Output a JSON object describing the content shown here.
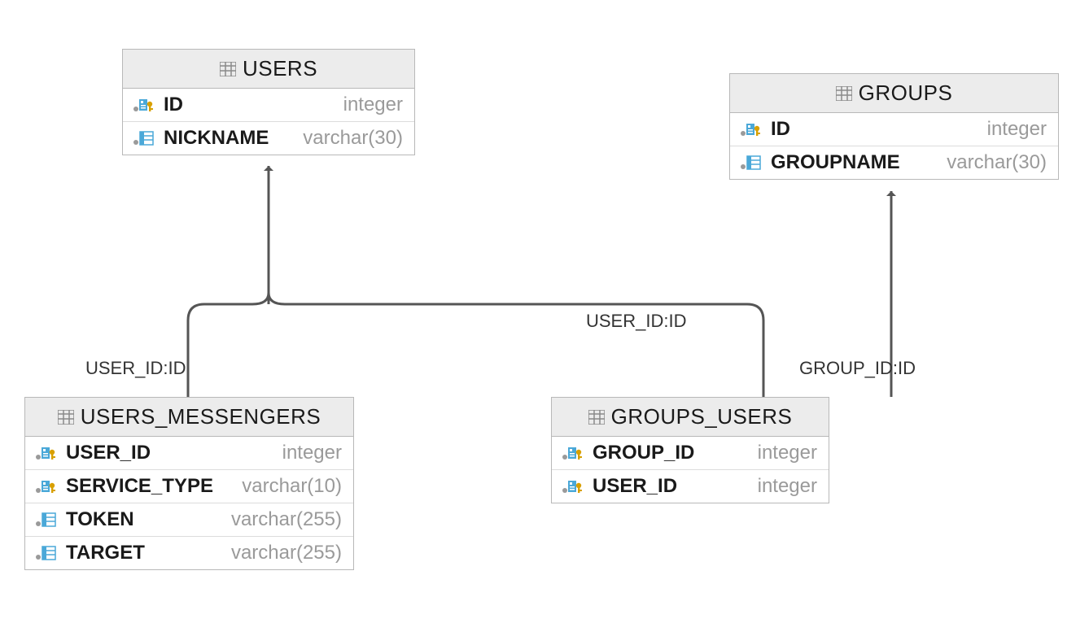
{
  "tables": {
    "users": {
      "title": "USERS",
      "columns": [
        {
          "name": "ID",
          "type": "integer",
          "icon": "pk"
        },
        {
          "name": "NICKNAME",
          "type": "varchar(30)",
          "icon": "col"
        }
      ]
    },
    "groups": {
      "title": "GROUPS",
      "columns": [
        {
          "name": "ID",
          "type": "integer",
          "icon": "pk"
        },
        {
          "name": "GROUPNAME",
          "type": "varchar(30)",
          "icon": "col"
        }
      ]
    },
    "users_messengers": {
      "title": "USERS_MESSENGERS",
      "columns": [
        {
          "name": "USER_ID",
          "type": "integer",
          "icon": "pk"
        },
        {
          "name": "SERVICE_TYPE",
          "type": "varchar(10)",
          "icon": "pk"
        },
        {
          "name": "TOKEN",
          "type": "varchar(255)",
          "icon": "col"
        },
        {
          "name": "TARGET",
          "type": "varchar(255)",
          "icon": "col"
        }
      ]
    },
    "groups_users": {
      "title": "GROUPS_USERS",
      "columns": [
        {
          "name": "GROUP_ID",
          "type": "integer",
          "icon": "pk"
        },
        {
          "name": "USER_ID",
          "type": "integer",
          "icon": "pk"
        }
      ]
    }
  },
  "relationships": [
    {
      "label": "USER_ID:ID",
      "from": "users_messengers.USER_ID",
      "to": "users.ID"
    },
    {
      "label": "USER_ID:ID",
      "from": "groups_users.USER_ID",
      "to": "users.ID"
    },
    {
      "label": "GROUP_ID:ID",
      "from": "groups_users.GROUP_ID",
      "to": "groups.ID"
    }
  ],
  "colors": {
    "border": "#b8b8b8",
    "header_bg": "#ececec",
    "type_text": "#9a9a9a",
    "key_gold": "#d8a000",
    "blue": "#4aa8d8",
    "grey_dot": "#9a9a9a",
    "connector": "#555555"
  }
}
